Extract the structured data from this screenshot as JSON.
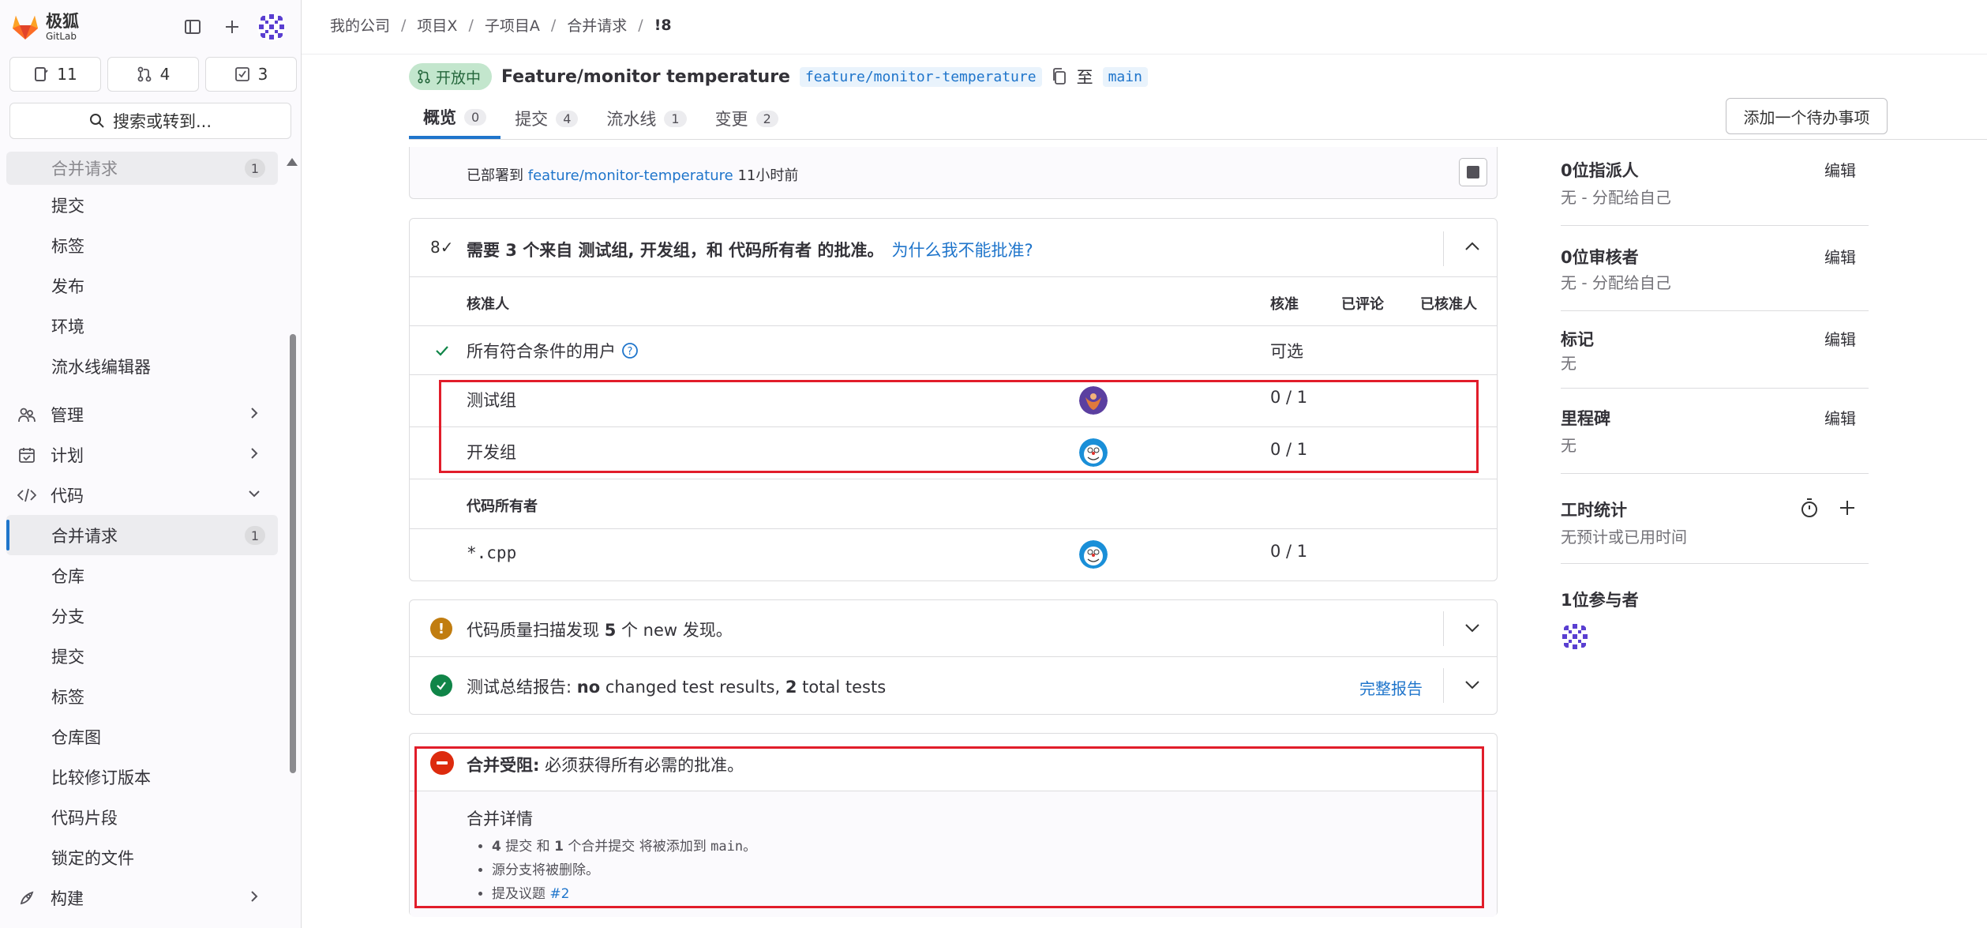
{
  "brand": {
    "name": "极狐",
    "sub": "GitLab"
  },
  "counts": {
    "issues": "11",
    "merge_requests": "4",
    "todos": "3"
  },
  "search": {
    "label": "搜索或转到..."
  },
  "nav": {
    "faded_item": {
      "label": "合并请求",
      "count": "1"
    },
    "items_a": [
      "提交",
      "标签",
      "发布",
      "环境",
      "流水线编辑器"
    ],
    "manage": "管理",
    "plan": "计划",
    "code": "代码",
    "active": {
      "label": "合并请求",
      "count": "1"
    },
    "items_b": [
      "仓库",
      "分支",
      "提交",
      "标签",
      "仓库图",
      "比较修订版本",
      "代码片段",
      "锁定的文件"
    ],
    "build": "构建"
  },
  "breadcrumb": [
    "我的公司",
    "项目X",
    "子项目A",
    "合并请求",
    "!8"
  ],
  "mr": {
    "status": "开放中",
    "title": "Feature/monitor temperature",
    "source_branch": "feature/monitor-temperature",
    "to": "至",
    "target_branch": "main"
  },
  "tabs": [
    {
      "label": "概览",
      "count": "0"
    },
    {
      "label": "提交",
      "count": "4"
    },
    {
      "label": "流水线",
      "count": "1"
    },
    {
      "label": "变更",
      "count": "2"
    }
  ],
  "todo_button": "添加一个待办事项",
  "deploy": {
    "prefix": "已部署到",
    "branch": "feature/monitor-temperature",
    "time": "11小时前"
  },
  "approvals": {
    "icon": "8✓",
    "title": "需要 3 个来自 测试组, 开发组，和 代码所有者 的批准。",
    "why_link": "为什么我不能批准?",
    "columns": {
      "approver": "核准人",
      "approve": "核准",
      "commented": "已评论",
      "approved_by": "已核准人"
    },
    "eligible": {
      "label": "所有符合条件的用户",
      "value": "可选"
    },
    "groups": [
      {
        "name": "测试组",
        "progress": "0 / 1"
      },
      {
        "name": "开发组",
        "progress": "0 / 1"
      }
    ],
    "code_owners_header": "代码所有者",
    "code_owner_rule": {
      "pattern": "*.cpp",
      "progress": "0 / 1"
    }
  },
  "quality": {
    "prefix": "代码质量扫描发现",
    "count": "5",
    "suffix": "个 new 发现。"
  },
  "tests": {
    "prefix": "测试总结报告:",
    "no": "no",
    "mid": "changed test results,",
    "total": "2",
    "suffix": "total tests",
    "report_link": "完整报告"
  },
  "merge": {
    "blocked_label": "合并受阻:",
    "blocked_text": "必须获得所有必需的批准。",
    "details_title": "合并详情",
    "line1": {
      "n": "4",
      "a": "提交 和",
      "m": "1",
      "b": "个合并提交 将被添加到",
      "branch": "main",
      "end": "。"
    },
    "line2": "源分支将被删除。",
    "line3": {
      "text": "提及议题",
      "link": "#2"
    }
  },
  "right": {
    "assignee": {
      "title": "0位指派人",
      "value": "无 - 分配给自己",
      "edit": "编辑"
    },
    "reviewer": {
      "title": "0位审核者",
      "value": "无 - 分配给自己",
      "edit": "编辑"
    },
    "labels": {
      "title": "标记",
      "value": "无",
      "edit": "编辑"
    },
    "milestone": {
      "title": "里程碑",
      "value": "无",
      "edit": "编辑"
    },
    "time": {
      "title": "工时统计",
      "value": "无预计或已用时间"
    },
    "participants": {
      "title": "1位参与者"
    }
  },
  "colors": {
    "accent": "#1f75cb",
    "highlight": "#e11d2a",
    "success": "#108548",
    "warning": "#c17d10",
    "danger": "#dd2b0e"
  }
}
